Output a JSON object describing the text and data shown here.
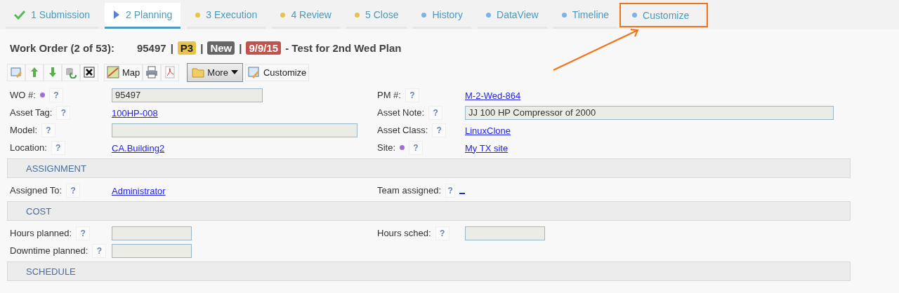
{
  "tabs": [
    {
      "label": "1 Submission",
      "kind": "done",
      "selected": false,
      "highlighted": false
    },
    {
      "label": "2 Planning",
      "kind": "current",
      "selected": true,
      "highlighted": false
    },
    {
      "label": "3 Execution",
      "kind": "pending",
      "selected": false,
      "highlighted": false
    },
    {
      "label": "4 Review",
      "kind": "pending",
      "selected": false,
      "highlighted": false
    },
    {
      "label": "5 Close",
      "kind": "pending",
      "selected": false,
      "highlighted": false
    },
    {
      "label": "History",
      "kind": "extra",
      "selected": false,
      "highlighted": false
    },
    {
      "label": "DataView",
      "kind": "extra",
      "selected": false,
      "highlighted": false
    },
    {
      "label": "Timeline",
      "kind": "extra",
      "selected": false,
      "highlighted": false
    },
    {
      "label": "Customize",
      "kind": "extra",
      "selected": false,
      "highlighted": true
    }
  ],
  "header": {
    "title": "Work Order (2 of 53):",
    "number": "95497",
    "badges": [
      {
        "label": "P3",
        "color": "#e8c24a"
      },
      {
        "label": "New",
        "color": "#666666"
      },
      {
        "label": "9/9/15",
        "color": "#c0534c"
      }
    ],
    "description": "- Test for 2nd Wed Plan",
    "separator": "|"
  },
  "toolbar": [
    {
      "kind": "edit"
    },
    {
      "kind": "up"
    },
    {
      "kind": "down"
    },
    {
      "kind": "refresh"
    },
    {
      "kind": "delete"
    },
    {
      "kind": "map",
      "label": "Map"
    },
    {
      "kind": "print"
    },
    {
      "kind": "pdf"
    },
    {
      "kind": "more",
      "label": "More"
    },
    {
      "kind": "customize",
      "label": "Customize"
    }
  ],
  "sections": [
    {
      "rows": [
        [
          {
            "label": "WO #:",
            "dot": true,
            "help": "?",
            "value": {
              "kind": "medium-input",
              "text": "95497"
            }
          },
          {
            "label": "PM #:",
            "dot": false,
            "help": "?",
            "value": {
              "kind": "link",
              "text": "M-2-Wed-864"
            }
          }
        ],
        [
          {
            "label": "Asset Tag:",
            "dot": false,
            "help": "?",
            "value": {
              "kind": "link",
              "text": "100HP-008"
            }
          },
          {
            "label": "Asset Note:",
            "dot": false,
            "help": "?",
            "value": {
              "kind": "wide-input",
              "text": "JJ 100 HP Compressor of 2000"
            }
          }
        ],
        [
          {
            "label": "Model:",
            "dot": false,
            "help": "?",
            "value": {
              "kind": "large-input"
            }
          },
          {
            "label": "Asset Class:",
            "dot": false,
            "help": "?",
            "value": {
              "kind": "link",
              "text": "LinuxClone"
            }
          }
        ],
        [
          {
            "label": "Location:",
            "dot": false,
            "help": "?",
            "value": {
              "kind": "link",
              "text": "CA.Building2"
            }
          },
          {
            "label": "Site:",
            "dot": true,
            "help": "?",
            "value": {
              "kind": "link",
              "text": "My TX site"
            }
          }
        ]
      ]
    },
    {
      "title": "ASSIGNMENT",
      "rows": [
        [
          {
            "label": "Assigned To:",
            "dot": false,
            "help": "?",
            "value": {
              "kind": "link",
              "text": "Administrator"
            }
          },
          {
            "label": "Team assigned:",
            "dot": false,
            "help": "?",
            "value": {
              "kind": "blank-link"
            }
          }
        ]
      ]
    },
    {
      "title": "COST",
      "rows": [
        [
          {
            "label": "Hours planned:",
            "dot": false,
            "help": "?",
            "value": {
              "kind": "small-input"
            }
          },
          {
            "label": "Hours sched:",
            "dot": false,
            "help": "?",
            "value": {
              "kind": "small-input"
            }
          }
        ],
        [
          {
            "label": "Downtime planned:",
            "dot": false,
            "help": "?",
            "value": {
              "kind": "small-input"
            }
          },
          null
        ]
      ]
    },
    {
      "title": "SCHEDULE"
    }
  ]
}
